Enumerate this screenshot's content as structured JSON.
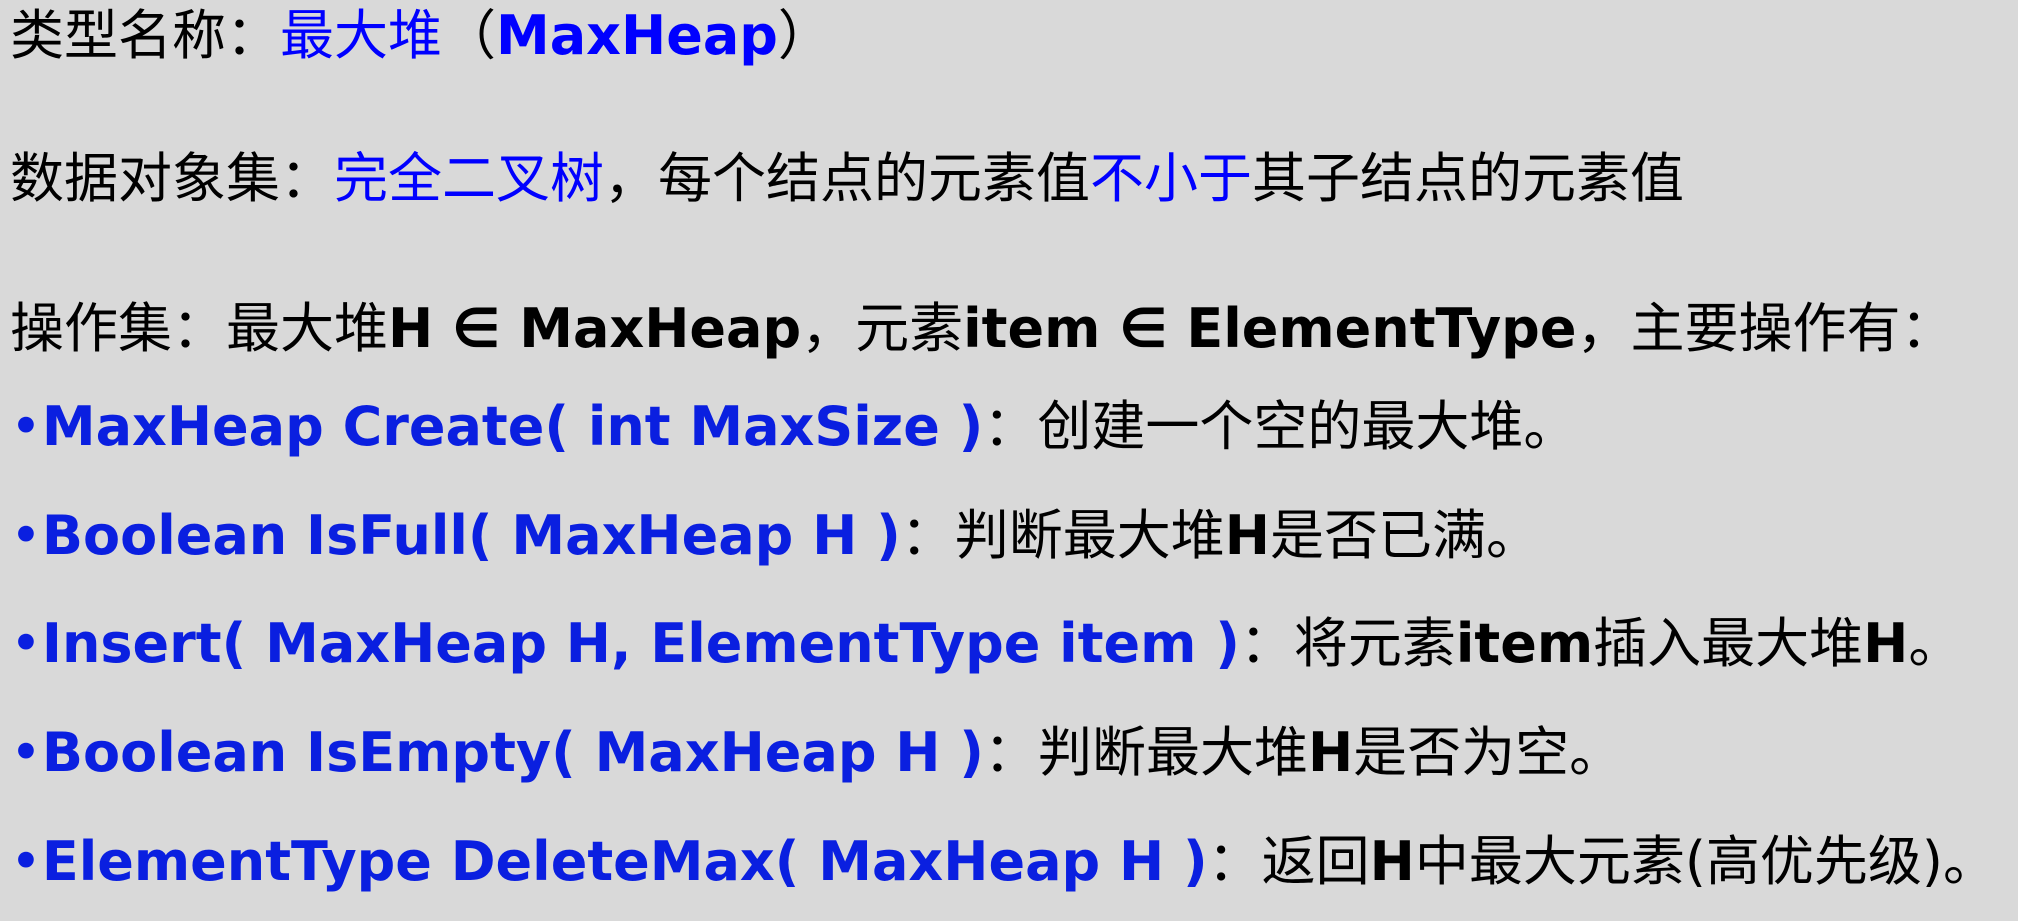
{
  "colors": {
    "background": "#d9d9d9",
    "text": "#000000",
    "accent_blue": "#0000ff",
    "signature_blue": "#0a1fe0"
  },
  "type_line": {
    "label": "类型名称：",
    "value_cn": "最大堆",
    "value_paren_open": "（",
    "value_en": "MaxHeap",
    "value_paren_close": "）"
  },
  "data_line": {
    "label": "数据对象集：",
    "highlight1": "完全二叉树",
    "middle": "，每个结点的元素值",
    "highlight2": "不小于",
    "end": "其子结点的元素值"
  },
  "ops_line": {
    "text_a": "操作集：最大堆",
    "h": "H",
    "member1": " ∈ MaxHeap",
    "comma1": "，元素",
    "item": "item",
    "member2": " ∈ ElementType",
    "tail": "，主要操作有："
  },
  "operations": [
    {
      "bullet": "•",
      "signature": "MaxHeap Create( int MaxSize )",
      "desc_parts": [
        "：创建一个空的最大堆。"
      ]
    },
    {
      "bullet": "•",
      "signature": "Boolean IsFull( MaxHeap H )",
      "desc_a": "：判断最大堆",
      "desc_bold": "H",
      "desc_b": "是否已满。"
    },
    {
      "bullet": "•",
      "signature": "Insert( MaxHeap H, ElementType item )",
      "desc_a": "：将元素",
      "desc_bold1": "item",
      "desc_b": "插入最大堆",
      "desc_bold2": "H",
      "desc_c": "。"
    },
    {
      "bullet": "•",
      "signature": "Boolean IsEmpty( MaxHeap H )",
      "desc_a": "：判断最大堆",
      "desc_bold": "H",
      "desc_b": "是否为空。"
    },
    {
      "bullet": "•",
      "signature": "ElementType DeleteMax( MaxHeap H )",
      "desc_a": "：返回",
      "desc_bold": "H",
      "desc_b": "中最大元素(高优先级)。"
    }
  ]
}
